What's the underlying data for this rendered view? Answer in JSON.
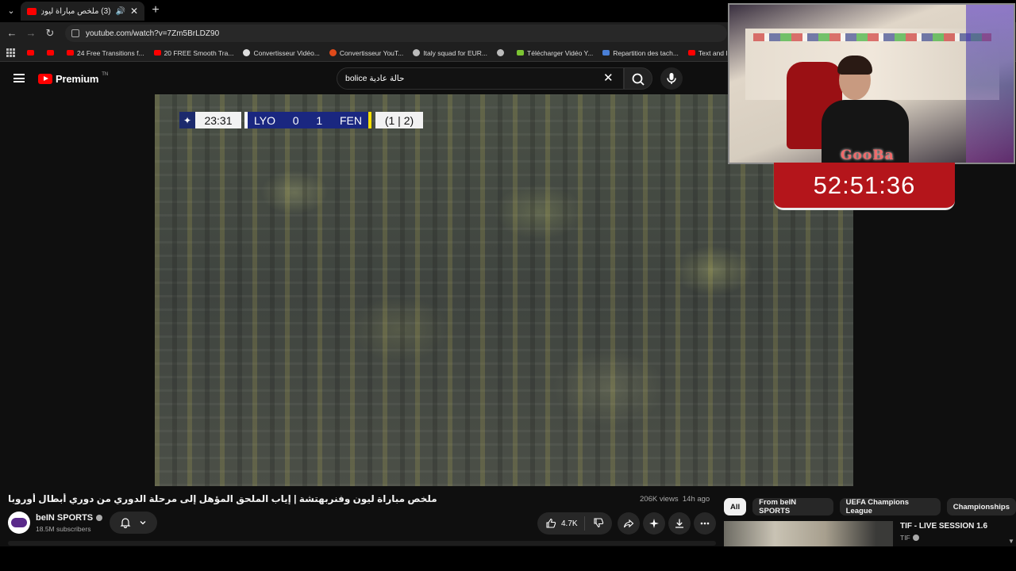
{
  "browser": {
    "tab_title": "(3) ملخص مباراة ليون وفنربهتشة | إياب",
    "url": "youtube.com/watch?v=7Zm5BrLDZ90",
    "bookmarks": [
      {
        "label": "",
        "color": "#ff0000"
      },
      {
        "label": "",
        "color": "#ff0000"
      },
      {
        "label": "24 Free Transitions f...",
        "color": "#ff0000"
      },
      {
        "label": "20 FREE Smooth Tra...",
        "color": "#ff0000"
      },
      {
        "label": "Convertisseur Vidéo...",
        "color": "#dddddd"
      },
      {
        "label": "Convertisseur YouT...",
        "color": "#e04a1a"
      },
      {
        "label": "Italy squad for EUR...",
        "color": "#bbbbbb"
      },
      {
        "label": "",
        "color": "#bbbbbb"
      },
      {
        "label": "Télécharger Vidéo Y...",
        "color": "#7cc432"
      },
      {
        "label": "Repartition des tach...",
        "color": "#4a7fd6"
      },
      {
        "label": "Text and Image ani...",
        "color": "#ff0000"
      }
    ]
  },
  "youtube": {
    "logo_text": "Premium",
    "logo_tm": "TN",
    "search_value": "bolice حالة عادية"
  },
  "scorebug": {
    "time": "23:31",
    "home": "LYO",
    "home_score": "0",
    "away_score": "1",
    "away": "FEN",
    "aggregate": "(1 | 2)"
  },
  "overlay": {
    "streamer_tag": "GooBa",
    "timer": "52:51:36"
  },
  "video": {
    "title": "ملخص مباراة ليون وفنربهتشة | إياب الملحق المؤهل إلى مرحلة الدوري من دوري أبطال أوروبا",
    "views": "206K views",
    "age": "14h ago",
    "channel": "beIN SPORTS",
    "subscribers": "18.5M subscribers",
    "likes": "4.7K"
  },
  "chips": [
    "All",
    "From beIN SPORTS",
    "UEFA Champions League",
    "Championships"
  ],
  "recommended": {
    "title": "TIF - LIVE SESSION 1.6",
    "channel": "TIF"
  },
  "colors": {
    "accent": "#ff0000",
    "timer_bg": "#b4151b",
    "scorebug_blue": "#1a2780"
  }
}
